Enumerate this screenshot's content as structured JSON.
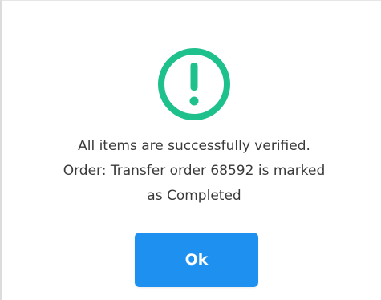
{
  "dialog": {
    "icon": "exclamation-circle-icon",
    "accent_color": "#1ec08c",
    "message_lines": [
      "All items are successfully verified.",
      "Order: Transfer order 68592 is marked",
      "as Completed"
    ],
    "ok_label": "Ok",
    "button_color": "#1e90f0"
  }
}
